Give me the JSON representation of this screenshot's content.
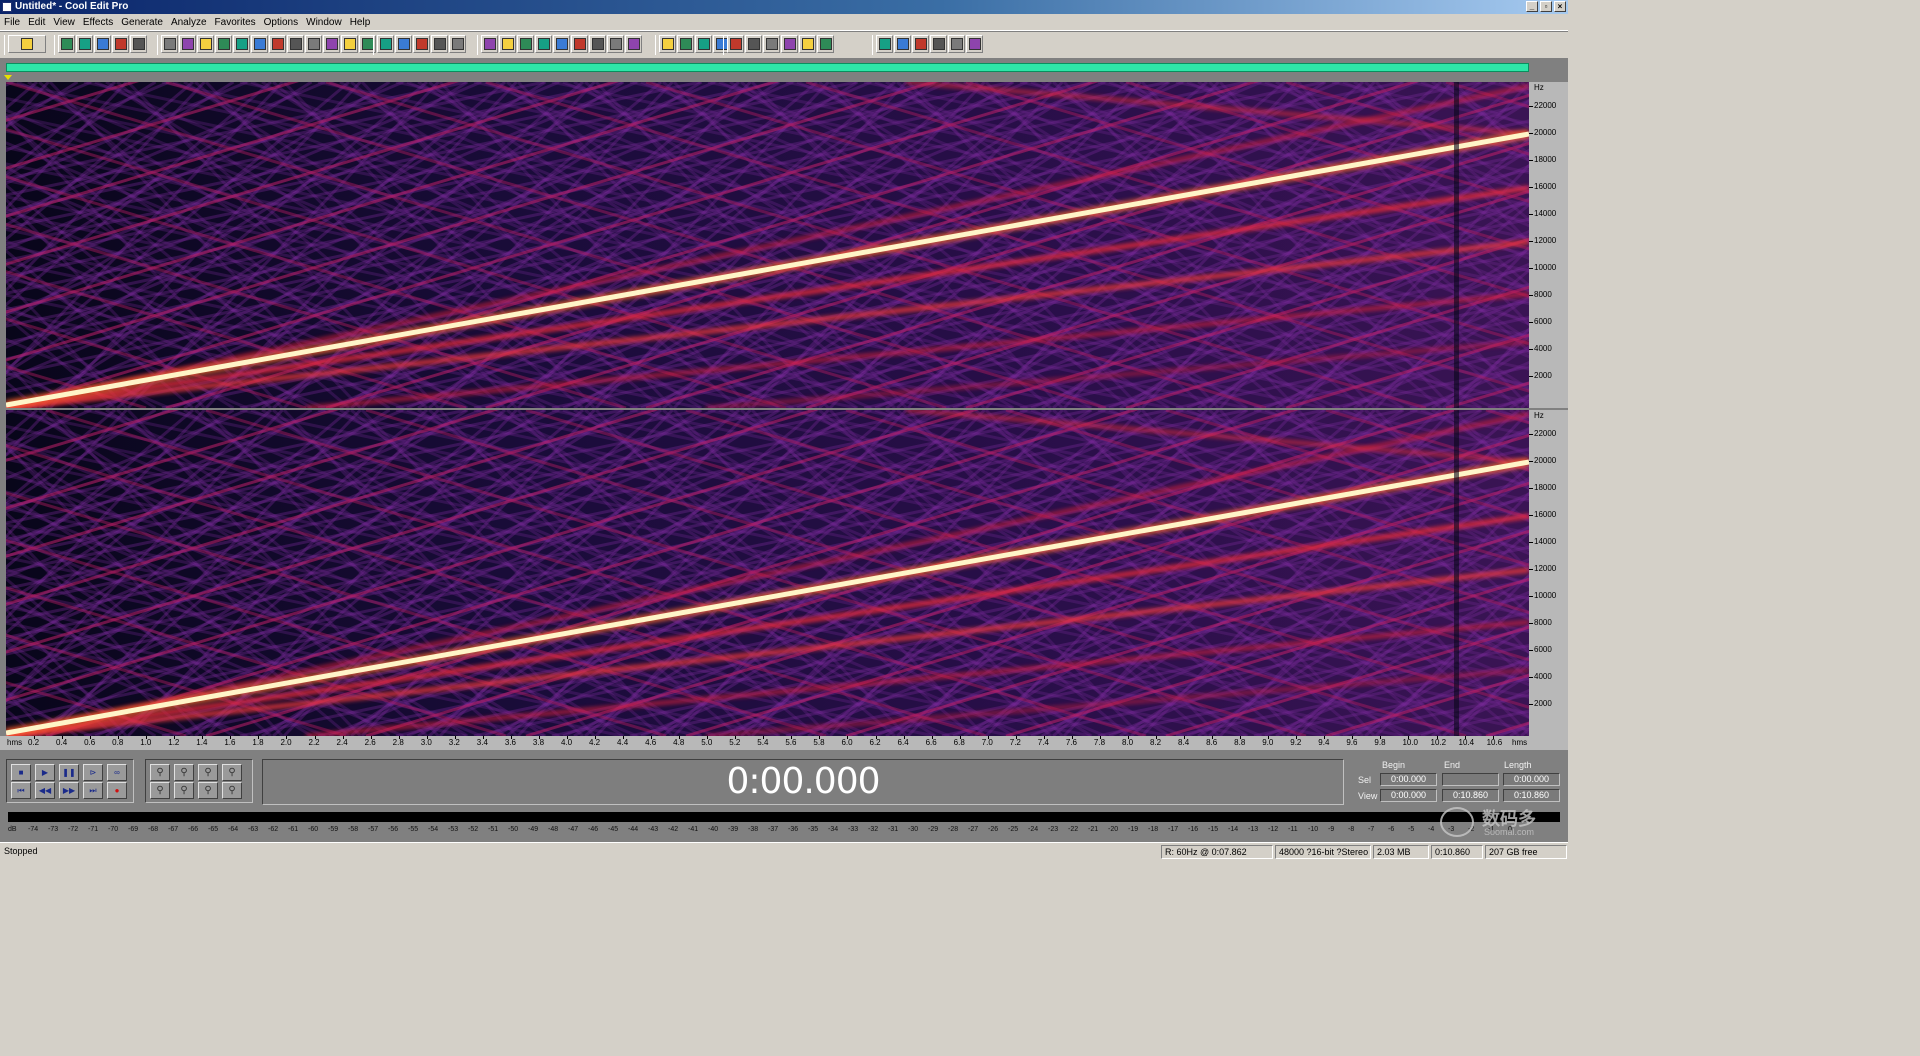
{
  "window": {
    "title": "Untitled* - Cool Edit Pro",
    "min_icon": "minimize-icon",
    "max_icon": "restore-icon",
    "close_icon": "close-icon"
  },
  "menu": [
    "File",
    "Edit",
    "View",
    "Effects",
    "Generate",
    "Analyze",
    "Favorites",
    "Options",
    "Window",
    "Help"
  ],
  "toolbar_icons": [
    "waveform-toggle",
    "new-file",
    "open-file",
    "save-file",
    "save-all",
    "close-file",
    "undo",
    "redo",
    "cut-tool",
    "copy",
    "cut",
    "paste",
    "paste-new",
    "mix-paste",
    "insert-cd",
    "record-cd",
    "envelope",
    "fade",
    "spectral",
    "zero-cross",
    "snap",
    "trim",
    "silence",
    "play-region",
    "loop",
    "transform",
    "mark-cue",
    "marker-list",
    "info",
    "help",
    "cd-player",
    "scripts",
    "find-beats",
    "batch",
    "favorites",
    "effect-chain",
    "effect-rack",
    "preset",
    "normalize",
    "amplify",
    "delay",
    "echo",
    "filter",
    "noise",
    "pitch",
    "reverb",
    "stretch",
    "settings"
  ],
  "hz_scale": {
    "unit": "Hz",
    "labels": [
      "22000",
      "20000",
      "18000",
      "16000",
      "14000",
      "12000",
      "10000",
      "8000",
      "6000",
      "4000",
      "2000"
    ]
  },
  "time_scale": {
    "start": "hms",
    "end": "hms",
    "labels": [
      "0.2",
      "0.4",
      "0.6",
      "0.8",
      "1.0",
      "1.2",
      "1.4",
      "1.6",
      "1.8",
      "2.0",
      "2.2",
      "2.4",
      "2.6",
      "2.8",
      "3.0",
      "3.2",
      "3.4",
      "3.6",
      "3.8",
      "4.0",
      "4.2",
      "4.4",
      "4.6",
      "4.8",
      "5.0",
      "5.2",
      "5.4",
      "5.6",
      "5.8",
      "6.0",
      "6.2",
      "6.4",
      "6.6",
      "6.8",
      "7.0",
      "7.2",
      "7.4",
      "7.6",
      "7.8",
      "8.0",
      "8.2",
      "8.4",
      "8.6",
      "8.8",
      "9.0",
      "9.2",
      "9.4",
      "9.6",
      "9.8",
      "10.0",
      "10.2",
      "10.4",
      "10.6"
    ]
  },
  "transport": {
    "buttons": [
      "stop",
      "play",
      "pause",
      "play-to-end",
      "loop",
      "go-to-start",
      "rewind",
      "fast-forward",
      "go-to-end",
      "record"
    ]
  },
  "zoom": {
    "buttons": [
      "zoom-in-horizontal",
      "zoom-out-horizontal",
      "zoom-full",
      "zoom-in-vertical",
      "zoom-to-selection",
      "zoom-to-left",
      "zoom-to-right",
      "zoom-out-vertical"
    ]
  },
  "time_display": "0:00.000",
  "selection": {
    "headers": [
      "Begin",
      "End",
      "Length"
    ],
    "sel_label": "Sel",
    "view_label": "View",
    "sel": [
      "0:00.000",
      "",
      "0:00.000"
    ],
    "view": [
      "0:00.000",
      "0:10.860",
      "0:10.860"
    ]
  },
  "level_meter": {
    "labels": [
      "dB",
      "-74",
      "-73",
      "-72",
      "-71",
      "-70",
      "-69",
      "-68",
      "-67",
      "-66",
      "-65",
      "-64",
      "-63",
      "-62",
      "-61",
      "-60",
      "-59",
      "-58",
      "-57",
      "-56",
      "-55",
      "-54",
      "-53",
      "-52",
      "-51",
      "-50",
      "-49",
      "-48",
      "-47",
      "-46",
      "-45",
      "-44",
      "-43",
      "-42",
      "-41",
      "-40",
      "-39",
      "-38",
      "-37",
      "-36",
      "-35",
      "-34",
      "-33",
      "-32",
      "-31",
      "-30",
      "-29",
      "-28",
      "-27",
      "-26",
      "-25",
      "-24",
      "-23",
      "-22",
      "-21",
      "-20",
      "-19",
      "-18",
      "-17",
      "-16",
      "-15",
      "-14",
      "-13",
      "-12",
      "-11",
      "-10",
      "-9",
      "-8",
      "-7",
      "-6",
      "-5",
      "-4",
      "-3",
      "-2",
      "-1",
      "0"
    ]
  },
  "status": {
    "state": "Stopped",
    "cursor": "R: 60Hz @  0:07.862",
    "format": "48000 ?16-bit ?Stereo",
    "size": "2.03 MB",
    "duration": "0:10.860",
    "free": "207 GB free"
  },
  "watermark": {
    "text": "数码多",
    "sub": "Soomal.com"
  },
  "colors": {
    "bg_dark": "#0a0820",
    "purple": "#6a1f8c",
    "red": "#e0203a",
    "hot": "#fff5c8",
    "overview": "#2ee6a8"
  }
}
